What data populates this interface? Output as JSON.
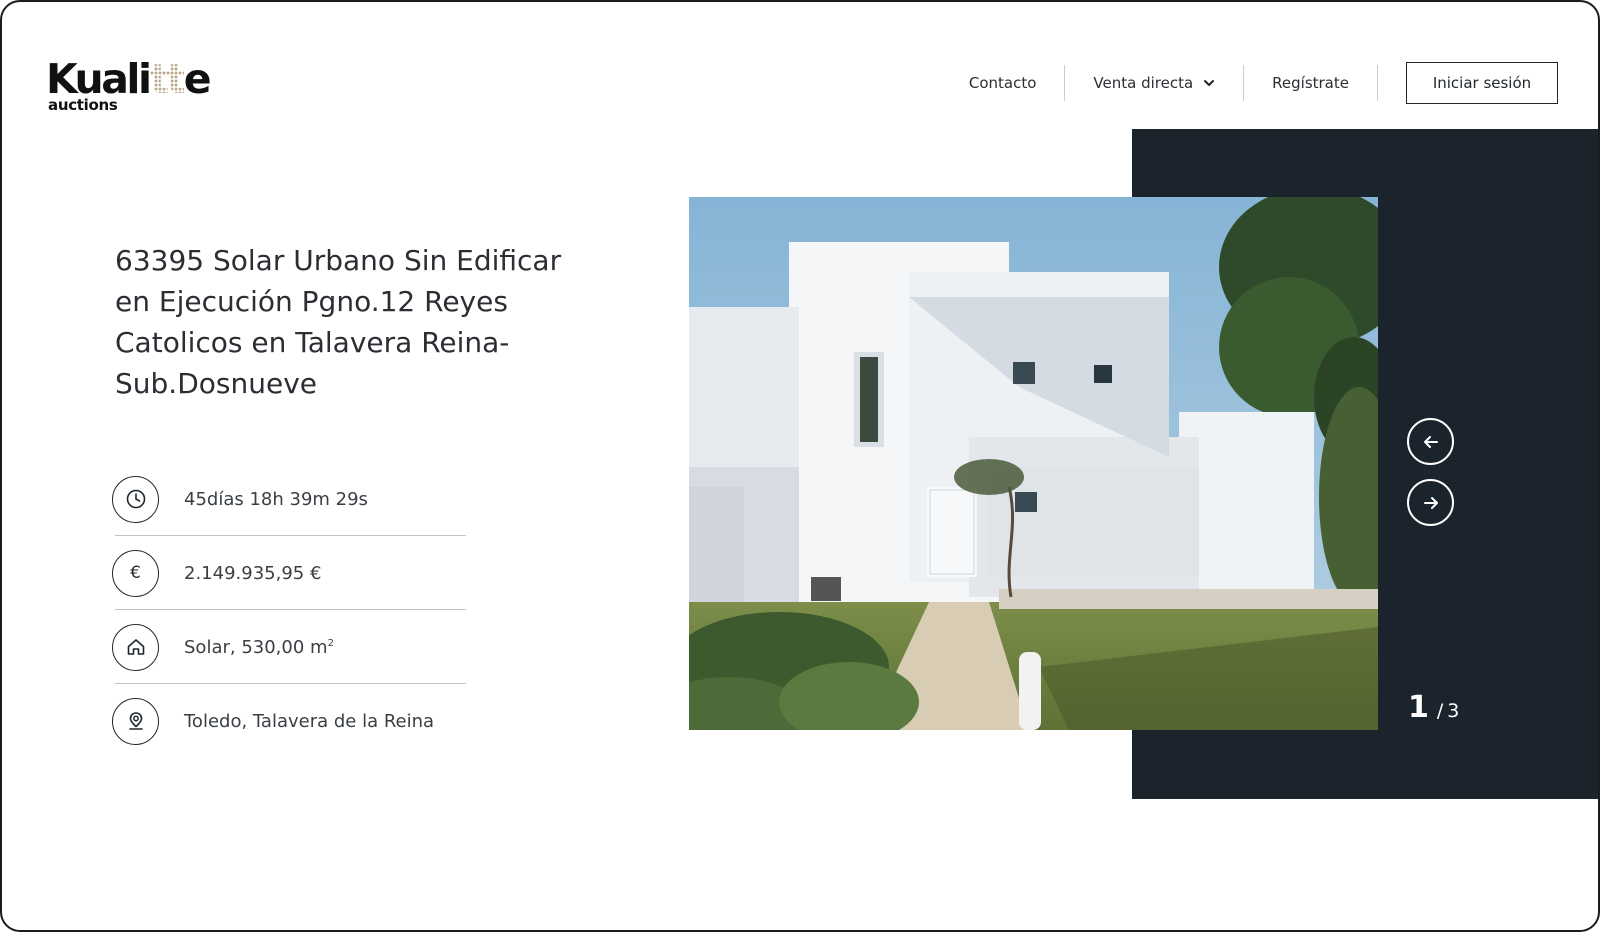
{
  "brand": {
    "logo_main_a": "Kuali",
    "logo_main_b": "tt",
    "logo_main_c": "e",
    "logo_sub": "auctions"
  },
  "nav": {
    "contact": "Contacto",
    "direct_sale": "Venta directa",
    "register": "Regístrate",
    "login": "Iniciar sesión"
  },
  "listing": {
    "title": "63395 Solar Urbano Sin Edificar en Ejecución Pgno.12 Reyes Catolicos en Talavera Reina-Sub.Dosnueve",
    "time_left": "45días 18h 39m 29s",
    "price": "2.149.935,95 €",
    "price_symbol": "€",
    "surface_text": "Solar, 530,00 m",
    "surface_unit_sup": "2",
    "location": "Toledo, Talavera de la Reina"
  },
  "carousel": {
    "current": "1",
    "separator": "/",
    "total": "3"
  },
  "colors": {
    "dark_panel": "#1b232d",
    "text": "#2b2f33",
    "accent_border": "#1f262d"
  },
  "icons": {
    "time": "clock-icon",
    "price": "euro-icon",
    "surface": "house-icon",
    "location": "location-pin-icon",
    "prev": "arrow-left-icon",
    "next": "arrow-right-icon",
    "dropdown": "chevron-down-icon"
  }
}
